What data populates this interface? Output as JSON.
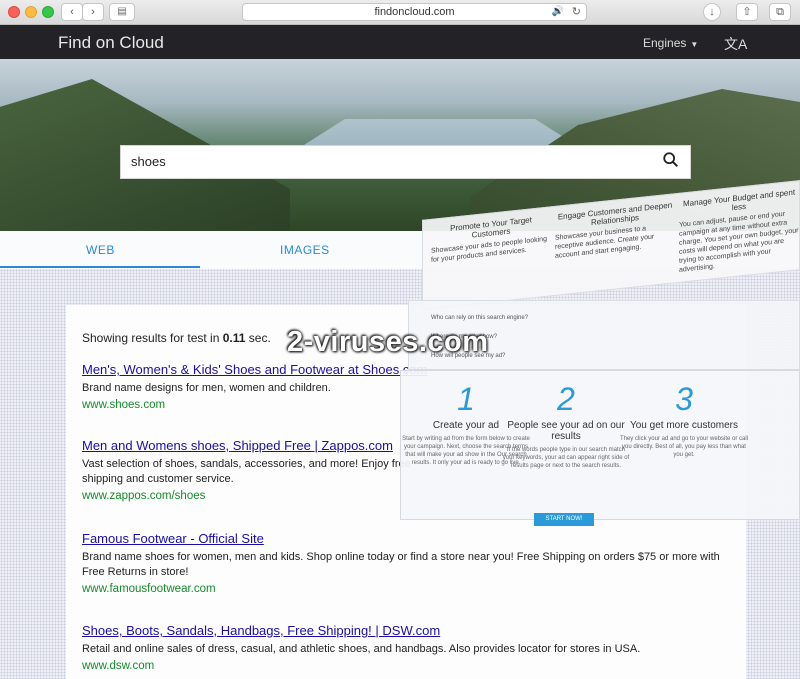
{
  "browser": {
    "url": "findoncloud.com"
  },
  "header": {
    "brand": "Find on Cloud",
    "engines_label": "Engines"
  },
  "search": {
    "query": "shoes"
  },
  "tabs": [
    {
      "label": "WEB",
      "active": true
    },
    {
      "label": "IMAGES",
      "active": false
    }
  ],
  "results_summary": {
    "prefix": "Showing results for test in ",
    "time": "0.11",
    "suffix": " sec."
  },
  "results": [
    {
      "title": "Men's, Women's & Kids' Shoes and Footwear at Shoes.com",
      "description": "Brand name designs for men, women and children.",
      "url": "www.shoes.com"
    },
    {
      "title": "Men and Womens shoes, Shipped Free | Zappos.com",
      "description": "Vast selection of shoes, sandals, accessories, and more! Enjoy free shipping and customer service.",
      "url": "www.zappos.com/shoes"
    },
    {
      "title": "Famous Footwear - Official Site",
      "description": "Brand name shoes for women, men and kids. Shop online today or find a store near you! Free Shipping on orders $75 or more with Free Returns in store!",
      "url": "www.famousfootwear.com"
    },
    {
      "title": "Shoes, Boots, Sandals, Handbags, Free Shipping! | DSW.com",
      "description": "Retail and online sales of dress, casual, and athletic shoes, and handbags. Also provides locator for stores in USA.",
      "url": "www.dsw.com"
    }
  ],
  "ad": {
    "columns": [
      {
        "heading": "Promote to Your Target Customers",
        "text": "Showcase your ads to people looking for your products and services."
      },
      {
        "heading": "Engage Customers and Deepen Relationships",
        "text": "Showcase your business to a receptive audience. Create your account and start engaging."
      },
      {
        "heading": "Manage Your Budget and spent less",
        "text": "You can adjust, pause or end your campaign at any time without extra charge. You set your own budget, your costs will depend on what you are trying to accomplish with your advertising."
      }
    ],
    "questions": [
      "Who can rely on this search engine?",
      "Where do my ads show?",
      "How will people see my ad?"
    ],
    "steps": [
      {
        "num": "1",
        "title": "Create your ad",
        "desc": "Start by writing ad from the form below to create your campaign. Next, choose the search terms that will make your ad show in the Our search results. It only your ad is ready to go live."
      },
      {
        "num": "2",
        "title": "People see your ad on our results",
        "desc": "If the words people type in our search match your keywords, your ad can appear right side of results page or next to the search results."
      },
      {
        "num": "3",
        "title": "You get more customers",
        "desc": "They click your ad and go to your website or call you directly. Best of all, you pay less than what you get."
      }
    ],
    "cta": "START NOW!"
  },
  "watermark": "2-viruses.com",
  "colors": {
    "accent": "#2a8ad6",
    "link": "#1a0dab",
    "url_green": "#148a2a",
    "header_bg": "#232327"
  }
}
